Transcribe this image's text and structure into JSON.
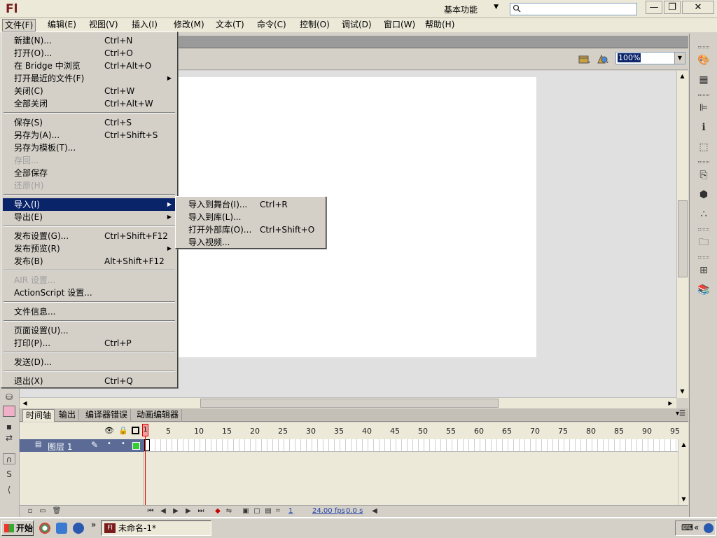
{
  "window": {
    "app_logo": "Fl",
    "workspace_label": "基本功能",
    "search_placeholder": "",
    "minimize": "—",
    "restore": "❐",
    "close": "✕"
  },
  "menubar": [
    {
      "label": "文件(F)",
      "name": "menu-file"
    },
    {
      "label": "编辑(E)",
      "name": "menu-edit"
    },
    {
      "label": "视图(V)",
      "name": "menu-view"
    },
    {
      "label": "插入(I)",
      "name": "menu-insert"
    },
    {
      "label": "修改(M)",
      "name": "menu-modify"
    },
    {
      "label": "文本(T)",
      "name": "menu-text"
    },
    {
      "label": "命令(C)",
      "name": "menu-commands"
    },
    {
      "label": "控制(O)",
      "name": "menu-control"
    },
    {
      "label": "调试(D)",
      "name": "menu-debug"
    },
    {
      "label": "窗口(W)",
      "name": "menu-window"
    },
    {
      "label": "帮助(H)",
      "name": "menu-help"
    }
  ],
  "file_menu": {
    "items": [
      {
        "label": "新建(N)...",
        "shortcut": "Ctrl+N"
      },
      {
        "label": "打开(O)...",
        "shortcut": "Ctrl+O"
      },
      {
        "label": "在 Bridge 中浏览",
        "shortcut": "Ctrl+Alt+O"
      },
      {
        "label": "打开最近的文件(F)",
        "shortcut": "",
        "submenu": true
      },
      {
        "label": "关闭(C)",
        "shortcut": "Ctrl+W"
      },
      {
        "label": "全部关闭",
        "shortcut": "Ctrl+Alt+W"
      },
      {
        "label": "保存(S)",
        "shortcut": "Ctrl+S"
      },
      {
        "label": "另存为(A)...",
        "shortcut": "Ctrl+Shift+S"
      },
      {
        "label": "另存为模板(T)...",
        "shortcut": ""
      },
      {
        "label": "存回...",
        "shortcut": "",
        "disabled": true
      },
      {
        "label": "全部保存",
        "shortcut": ""
      },
      {
        "label": "还原(H)",
        "shortcut": "",
        "disabled": true
      },
      {
        "label": "导入(I)",
        "shortcut": "",
        "submenu": true,
        "highlighted": true
      },
      {
        "label": "导出(E)",
        "shortcut": "",
        "submenu": true
      },
      {
        "label": "发布设置(G)...",
        "shortcut": "Ctrl+Shift+F12"
      },
      {
        "label": "发布预览(R)",
        "shortcut": "",
        "submenu": true
      },
      {
        "label": "发布(B)",
        "shortcut": "Alt+Shift+F12"
      },
      {
        "label": "AIR 设置...",
        "shortcut": "",
        "disabled": true
      },
      {
        "label": "ActionScript 设置...",
        "shortcut": ""
      },
      {
        "label": "文件信息...",
        "shortcut": ""
      },
      {
        "label": "页面设置(U)...",
        "shortcut": ""
      },
      {
        "label": "打印(P)...",
        "shortcut": "Ctrl+P"
      },
      {
        "label": "发送(D)...",
        "shortcut": ""
      },
      {
        "label": "退出(X)",
        "shortcut": "Ctrl+Q"
      }
    ]
  },
  "import_submenu": {
    "items": [
      {
        "label": "导入到舞台(I)...",
        "shortcut": "Ctrl+R"
      },
      {
        "label": "导入到库(L)...",
        "shortcut": ""
      },
      {
        "label": "打开外部库(O)...",
        "shortcut": "Ctrl+Shift+O"
      },
      {
        "label": "导入视频...",
        "shortcut": ""
      }
    ]
  },
  "editbar": {
    "zoom": "100%"
  },
  "timeline": {
    "tabs": [
      "时间轴",
      "输出",
      "编译器错误",
      "动画编辑器"
    ],
    "ruler": [
      "1",
      "5",
      "10",
      "15",
      "20",
      "25",
      "30",
      "35",
      "40",
      "45",
      "50",
      "55",
      "60",
      "65",
      "70",
      "75",
      "80",
      "85",
      "90",
      "95"
    ],
    "layer_name": "图层 1",
    "current_frame": "1",
    "fps": "24.00 fps",
    "time": "0.0 s"
  },
  "taskbar": {
    "start_label": "开始",
    "task_title": "未命名-1*",
    "task_icon": "Fl",
    "chevron": "»",
    "tray_chevron": "«"
  },
  "colors": {
    "menu_highlight": "#0a246a",
    "layer_row": "#5b6b95",
    "playhead": "#dd0000",
    "brand": "#7a1c1c"
  }
}
